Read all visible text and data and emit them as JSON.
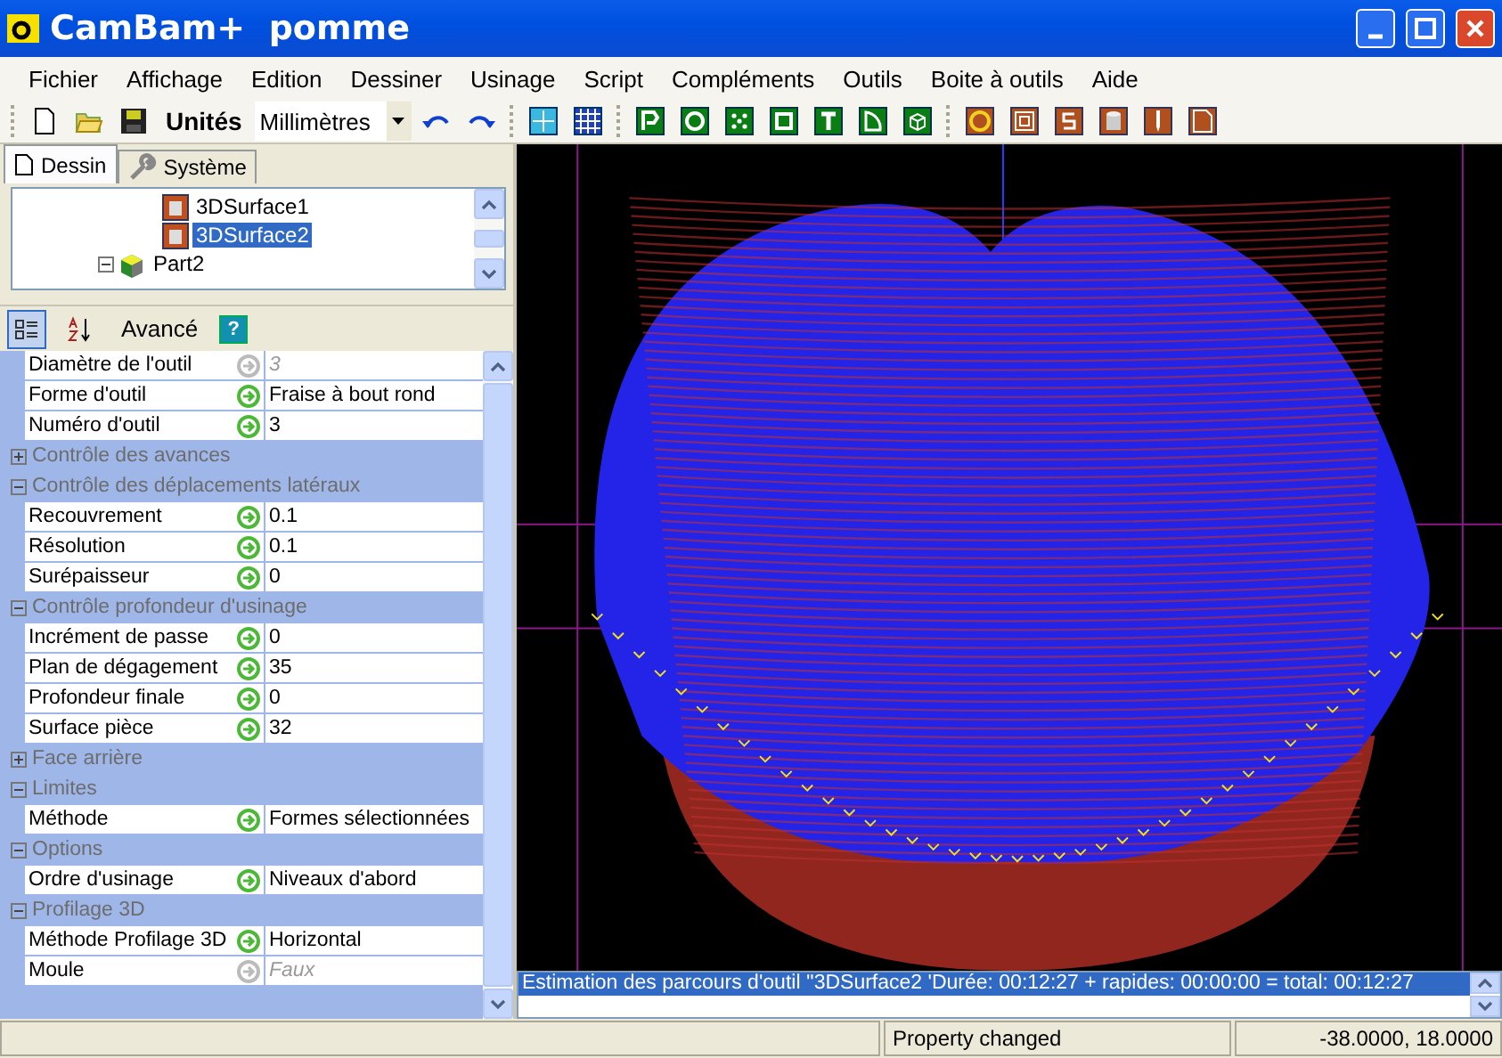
{
  "window": {
    "title": "CamBam+  pomme"
  },
  "menu": [
    "Fichier",
    "Affichage",
    "Edition",
    "Dessiner",
    "Usinage",
    "Script",
    "Compléments",
    "Outils",
    "Boite à outils",
    "Aide"
  ],
  "toolbar": {
    "units_label": "Unités",
    "units_value": "Millimètres"
  },
  "panel_tabs": [
    {
      "label": "Dessin",
      "selected": true
    },
    {
      "label": "Système",
      "selected": false
    }
  ],
  "tree": {
    "continued_children": [
      {
        "label": "3DSurface1",
        "selected": false
      },
      {
        "label": "3DSurface2",
        "selected": true
      }
    ],
    "nodes": [
      {
        "label": "Part2",
        "expanded": true,
        "selected": false
      }
    ]
  },
  "property_toolbar": {
    "advanced_label": "Avancé",
    "categorized": true,
    "help_label": "?"
  },
  "properties": [
    {
      "kind": "prop",
      "name": "Diamètre de l'outil",
      "value": "3",
      "inherited": true
    },
    {
      "kind": "prop",
      "name": "Forme d'outil",
      "value": "Fraise à bout rond",
      "inherited": false
    },
    {
      "kind": "prop",
      "name": "Numéro d'outil",
      "value": "3",
      "inherited": false
    },
    {
      "kind": "group",
      "name": "Contrôle des avances",
      "expanded": false
    },
    {
      "kind": "group",
      "name": "Contrôle des déplacements latéraux",
      "expanded": true
    },
    {
      "kind": "prop",
      "name": "Recouvrement",
      "value": "0.1",
      "inherited": false
    },
    {
      "kind": "prop",
      "name": "Résolution",
      "value": "0.1",
      "inherited": false
    },
    {
      "kind": "prop",
      "name": "Surépaisseur",
      "value": "0",
      "inherited": false
    },
    {
      "kind": "group",
      "name": "Contrôle profondeur d'usinage",
      "expanded": true
    },
    {
      "kind": "prop",
      "name": "Incrément de passe",
      "value": "0",
      "inherited": false
    },
    {
      "kind": "prop",
      "name": "Plan de dégagement",
      "value": "35",
      "inherited": false
    },
    {
      "kind": "prop",
      "name": "Profondeur finale",
      "value": "0",
      "inherited": false
    },
    {
      "kind": "prop",
      "name": "Surface pièce",
      "value": "32",
      "inherited": false
    },
    {
      "kind": "group",
      "name": "Face arrière",
      "expanded": false
    },
    {
      "kind": "group",
      "name": "Limites",
      "expanded": true
    },
    {
      "kind": "prop",
      "name": "Méthode",
      "value": "Formes sélectionnées",
      "inherited": false
    },
    {
      "kind": "group",
      "name": "Options",
      "expanded": true
    },
    {
      "kind": "prop",
      "name": "Ordre d'usinage",
      "value": "Niveaux d'abord",
      "inherited": false
    },
    {
      "kind": "group",
      "name": "Profilage 3D",
      "expanded": true
    },
    {
      "kind": "prop",
      "name": "Méthode Profilage 3D",
      "value": "Horizontal",
      "inherited": false
    },
    {
      "kind": "prop",
      "name": "Moule",
      "value": "Faux",
      "inherited": true
    }
  ],
  "log": [
    {
      "text": "Estimation des parcours d'outil ''3DSurface2 'Durée: 00:12:27 + rapides: 00:00:00 = total: 00:12:27",
      "selected": true
    }
  ],
  "status_bar": {
    "message": "Property changed",
    "coordinates": "-38.0000, 18.0000"
  }
}
